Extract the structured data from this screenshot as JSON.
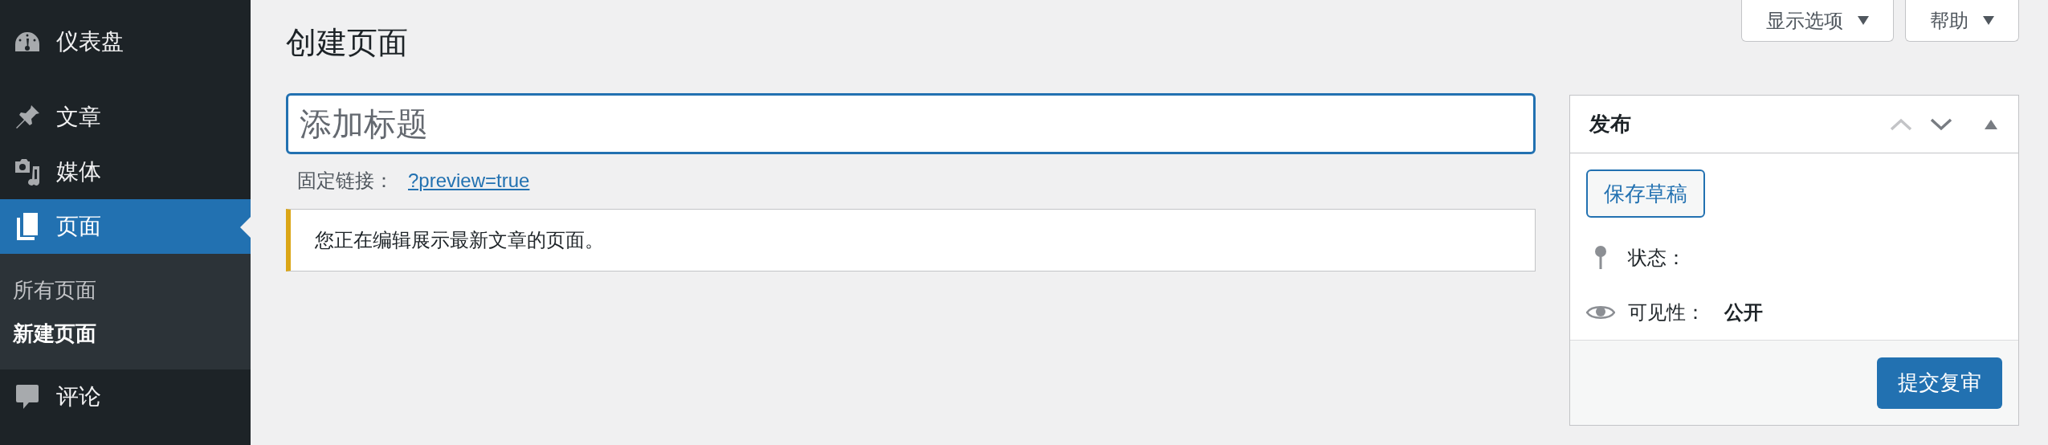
{
  "sidebar": {
    "items": [
      {
        "label": "仪表盘",
        "selected": false
      },
      {
        "label": "文章",
        "selected": false
      },
      {
        "label": "媒体",
        "selected": false
      },
      {
        "label": "页面",
        "selected": true,
        "children": [
          {
            "label": "所有页面",
            "selected": false
          },
          {
            "label": "新建页面",
            "selected": true
          }
        ]
      },
      {
        "label": "评论",
        "selected": false
      }
    ]
  },
  "top_buttons": [
    "显示选项",
    "帮助"
  ],
  "page_title": "创建页面",
  "title_field": {
    "placeholder": "添加标题"
  },
  "permalink": {
    "label": "固定链接：",
    "link": "?preview=true"
  },
  "notice": "您正在编辑展示最新文章的页面。",
  "publish_box": {
    "title": "发布",
    "save_draft": "保存草稿",
    "rows": [
      {
        "label": "状态："
      },
      {
        "label": "可见性：",
        "value": "公开"
      }
    ],
    "submit": "提交复审"
  }
}
